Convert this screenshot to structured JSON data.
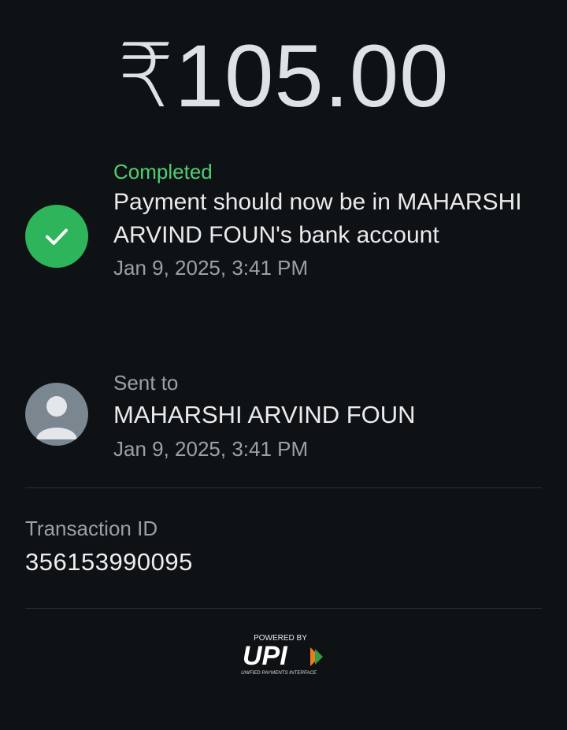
{
  "payment": {
    "amount": "₹105.00"
  },
  "status": {
    "label": "Completed",
    "message": "Payment should now be in MAHARSHI ARVIND FOUN's bank account",
    "timestamp": "Jan 9, 2025, 3:41 PM",
    "icon": "checkmark-icon",
    "color": "#2eb45a"
  },
  "recipient": {
    "label": "Sent to",
    "name": "MAHARSHI ARVIND FOUN",
    "timestamp": "Jan 9, 2025, 3:41 PM",
    "icon": "person-icon"
  },
  "transaction": {
    "label": "Transaction ID",
    "id": "356153990095"
  },
  "footer": {
    "powered_by": "POWERED BY",
    "brand": "UPI",
    "brand_subtitle": "UNIFIED PAYMENTS INTERFACE"
  }
}
